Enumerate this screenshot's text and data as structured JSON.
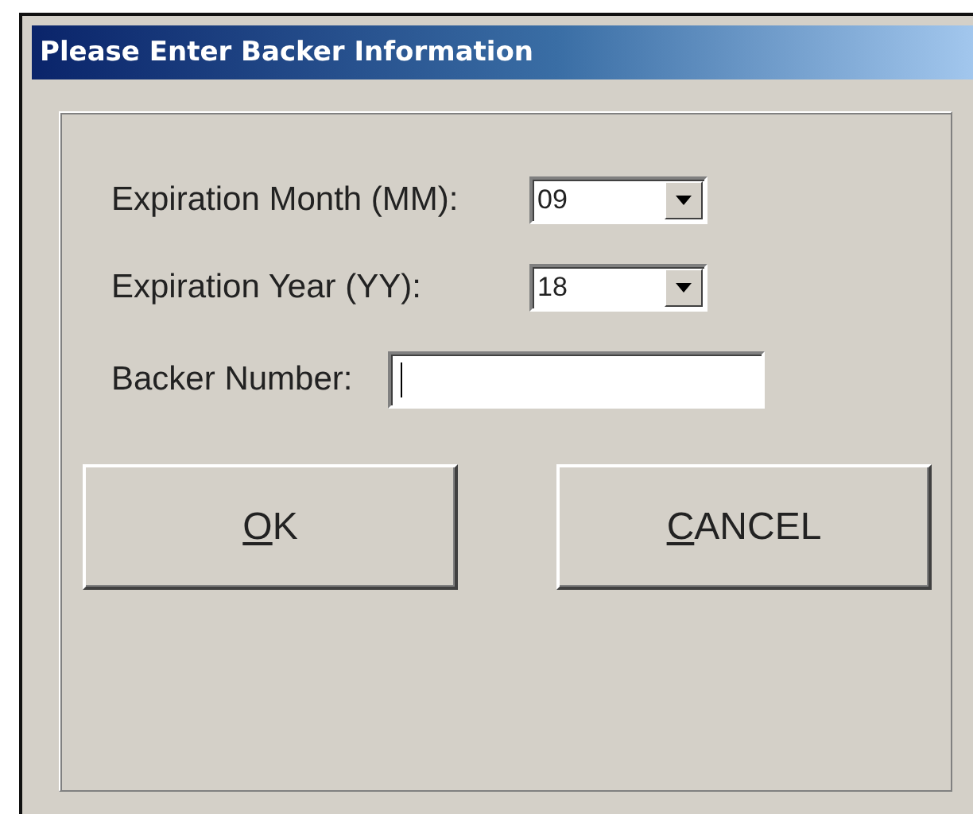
{
  "window": {
    "title": "Please Enter Backer Information"
  },
  "fields": [
    {
      "kind": "combo",
      "label": "Expiration Month (MM):",
      "value": "09"
    },
    {
      "kind": "combo",
      "label": "Expiration Year (YY):",
      "value": "18"
    },
    {
      "kind": "text",
      "label": "Backer Number:",
      "focused": true
    }
  ],
  "buttons": [
    {
      "label": "OK",
      "underline_first": true
    },
    {
      "label": "CANCEL",
      "underline_first": true
    }
  ]
}
